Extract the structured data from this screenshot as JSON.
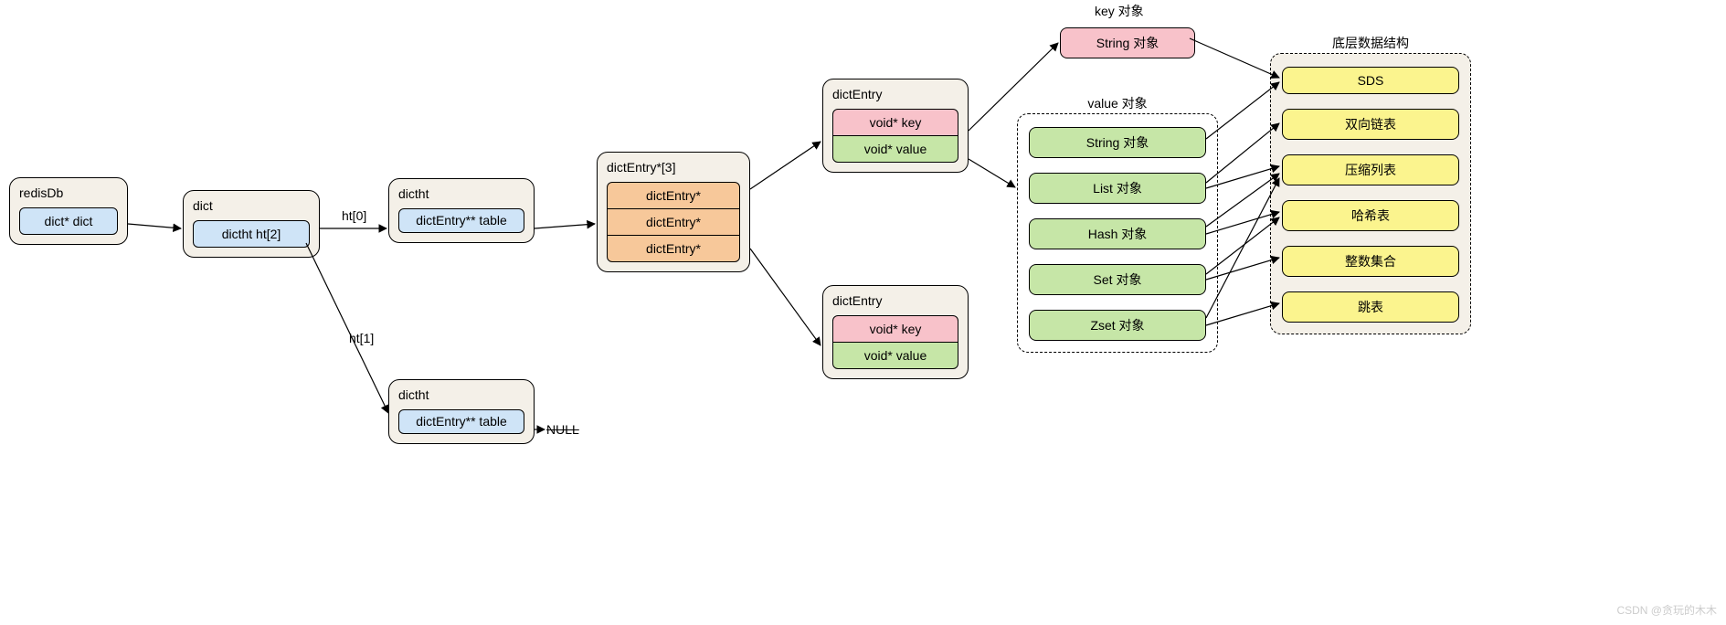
{
  "nodes": {
    "redisDb": {
      "title": "redisDb",
      "field": "dict* dict"
    },
    "dict": {
      "title": "dict",
      "field": "dictht ht[2]"
    },
    "dictht0": {
      "title": "dictht",
      "field": "dictEntry** table"
    },
    "dictht1": {
      "title": "dictht",
      "field": "dictEntry** table"
    },
    "entryArr": {
      "title": "dictEntry*[3]",
      "items": [
        "dictEntry*",
        "dictEntry*",
        "dictEntry*"
      ]
    },
    "entry1": {
      "title": "dictEntry",
      "key": "void* key",
      "value": "void* value"
    },
    "entry2": {
      "title": "dictEntry",
      "key": "void* key",
      "value": "void* value"
    }
  },
  "keyObj": {
    "title": "key 对象",
    "text": "String 对象"
  },
  "valueObj": {
    "title": "value 对象",
    "items": [
      "String 对象",
      "List 对象",
      "Hash 对象",
      "Set 对象",
      "Zset 对象"
    ]
  },
  "impl": {
    "title": "底层数据结构",
    "items": [
      "SDS",
      "双向链表",
      "压缩列表",
      "哈希表",
      "整数集合",
      "跳表"
    ]
  },
  "labels": {
    "ht0": "ht[0]",
    "ht1": "ht[1]",
    "null": "NULL"
  },
  "watermark": "CSDN @贪玩的木木"
}
